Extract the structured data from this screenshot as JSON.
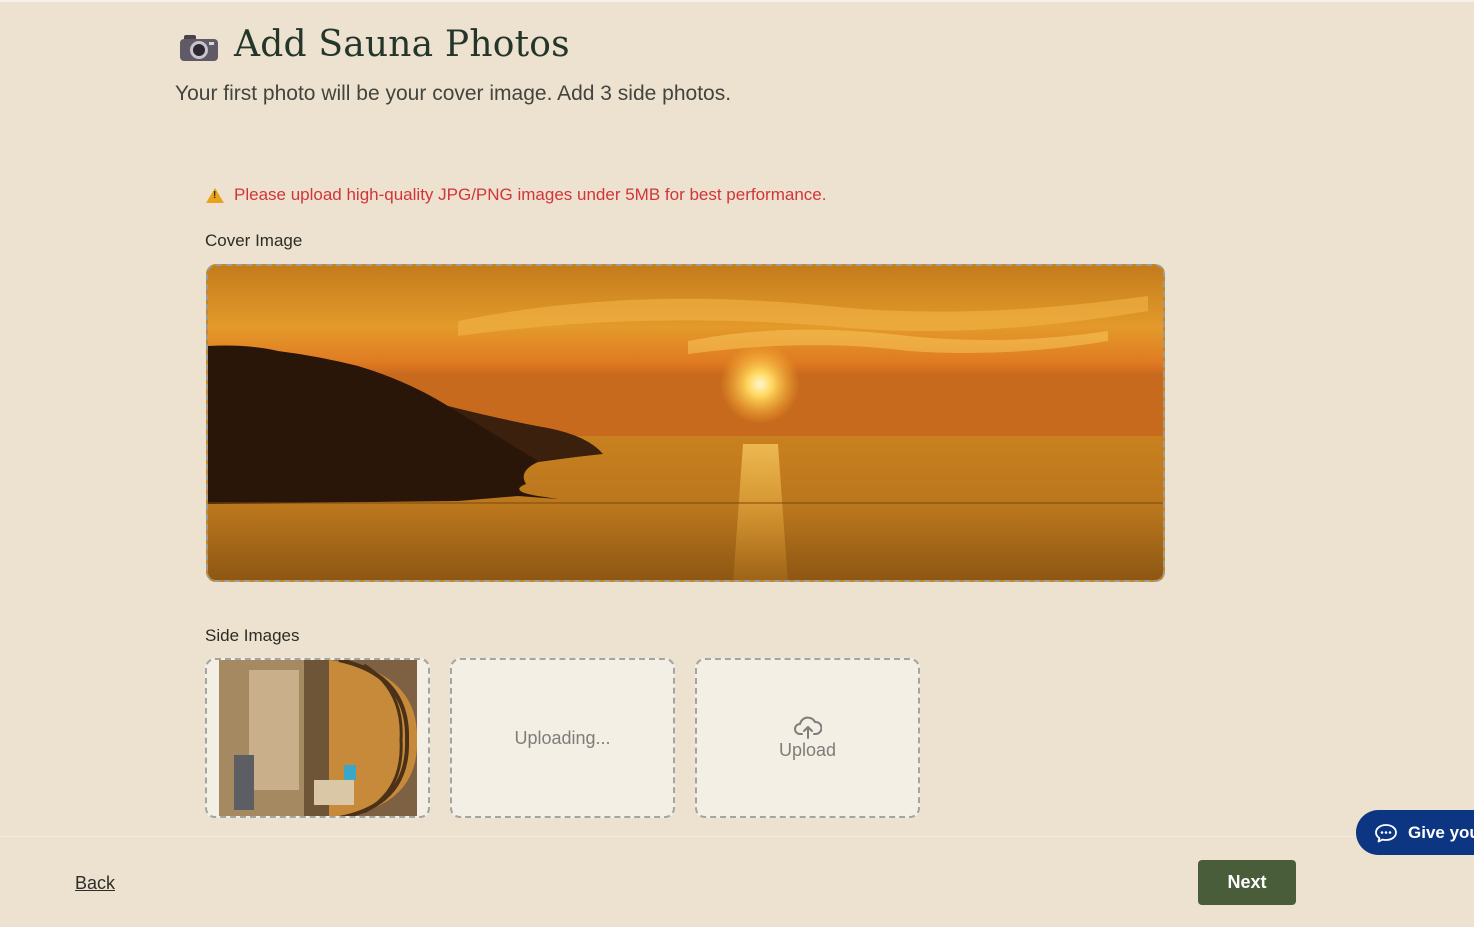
{
  "header": {
    "icon": "camera-icon",
    "title": "Add Sauna Photos",
    "subtitle": "Your first photo will be your cover image. Add 3 side photos."
  },
  "warning": {
    "icon": "warning-icon",
    "text": "Please upload high-quality JPG/PNG images under 5MB for best performance."
  },
  "cover": {
    "label": "Cover Image",
    "image_description_icon": "sunset-photo"
  },
  "side_images": {
    "label": "Side Images",
    "slots": [
      {
        "state": "filled",
        "image_icon": "barrel-sauna-photo"
      },
      {
        "state": "uploading",
        "text": "Uploading..."
      },
      {
        "state": "empty",
        "icon": "cloud-upload-icon",
        "text": "Upload"
      }
    ]
  },
  "footer": {
    "back_label": "Back",
    "next_label": "Next"
  },
  "feedback": {
    "icon": "chat-icon",
    "label": "Give you"
  },
  "colors": {
    "background": "#ede2cf",
    "accent_green": "#4a5d3a",
    "warning_red": "#d1353a",
    "feedback_blue": "#0c3582"
  }
}
